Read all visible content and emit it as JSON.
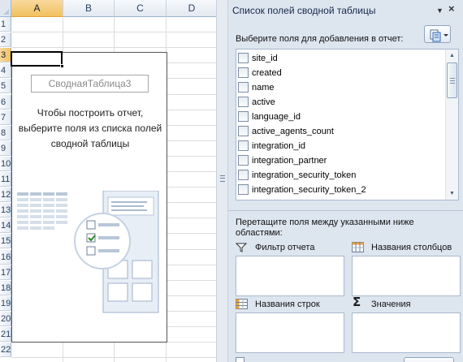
{
  "sheet": {
    "columns": [
      "A",
      "B",
      "C",
      "D"
    ],
    "rows": [
      "1",
      "2",
      "3",
      "4",
      "5",
      "6",
      "7",
      "8",
      "9",
      "10",
      "11",
      "12",
      "13",
      "14",
      "15",
      "16",
      "17",
      "18",
      "19",
      "20",
      "21",
      "22"
    ],
    "selected_column": "A",
    "selected_row": "3",
    "pivot_name": "СводнаяТаблица3",
    "pivot_hint": "Чтобы построить отчет, выберите поля из списка полей сводной таблицы"
  },
  "pane": {
    "title": "Список полей сводной таблицы",
    "choose_fields_label": "Выберите поля для добавления в отчет:",
    "fields": [
      {
        "name": "site_id",
        "checked": false
      },
      {
        "name": "created",
        "checked": false
      },
      {
        "name": "name",
        "checked": false
      },
      {
        "name": "active",
        "checked": false
      },
      {
        "name": "language_id",
        "checked": false
      },
      {
        "name": "active_agents_count",
        "checked": false
      },
      {
        "name": "integration_id",
        "checked": false
      },
      {
        "name": "integration_partner",
        "checked": false
      },
      {
        "name": "integration_security_token",
        "checked": false
      },
      {
        "name": "integration_security_token_2",
        "checked": false
      }
    ],
    "drag_label": "Перетащите поля между указанными ниже областями:",
    "areas": {
      "report_filter": "Фильтр отчета",
      "column_labels": "Названия столбцов",
      "row_labels": "Названия строк",
      "values": "Значения"
    },
    "icons": {
      "title_dropdown": "chevron-down-icon",
      "close": "close-icon",
      "layout": "layout-options-icon",
      "filter": "filter-funnel-icon",
      "columns": "table-columns-icon",
      "rows": "table-rows-icon",
      "values": "sigma-icon"
    }
  },
  "colors": {
    "pane_bg": "#dde5ef",
    "header_selected": "#f1c15f",
    "border": "#a9b8cc"
  }
}
